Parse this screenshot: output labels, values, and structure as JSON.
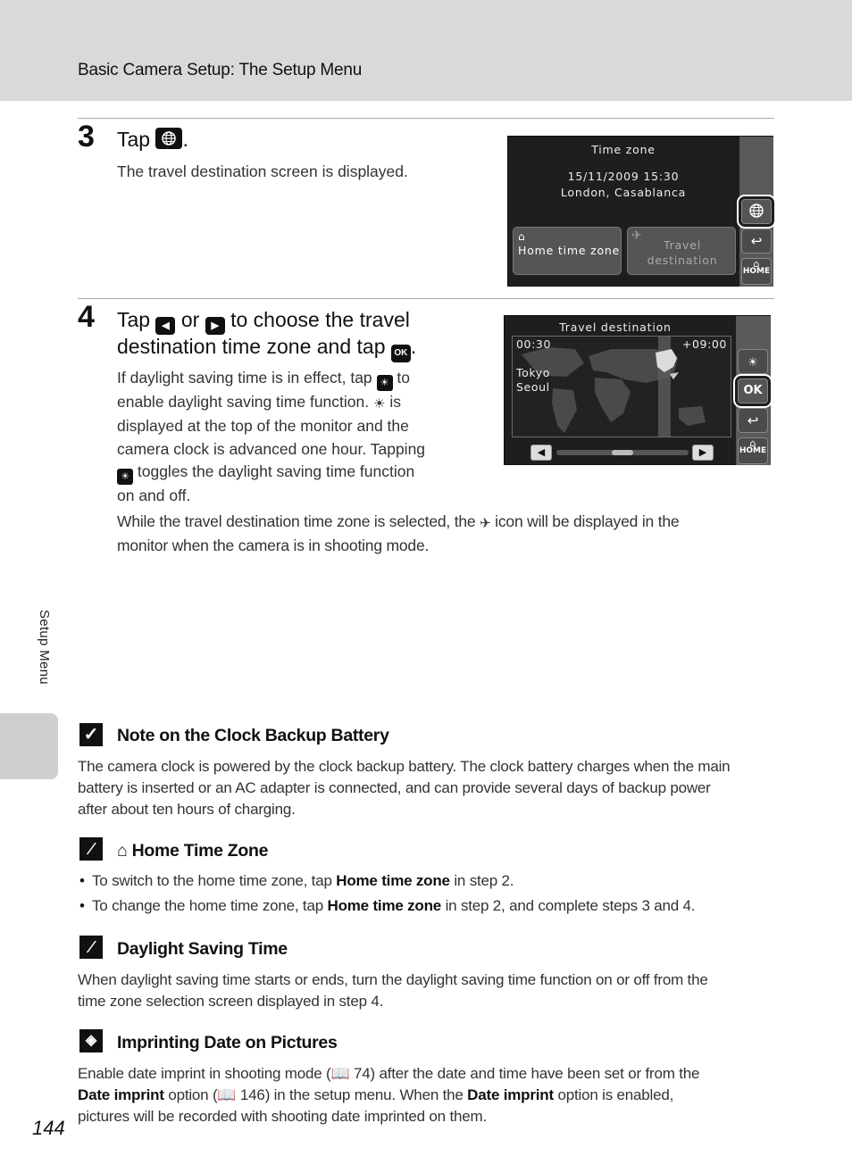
{
  "header": {
    "title": "Basic Camera Setup: The Setup Menu"
  },
  "side_tab": {
    "label": "Setup Menu"
  },
  "step3": {
    "number": "3",
    "heading_pre": "Tap",
    "heading_post": ".",
    "heading_icon": "globe-icon",
    "body": "The travel destination screen is displayed.",
    "screen": {
      "title": "Time zone",
      "datetime": "15/11/2009 15:30",
      "location": "London, Casablanca",
      "home_tile_label": "Home time zone",
      "travel_tile_label_1": "Travel",
      "travel_tile_label_2": "destination",
      "rail": [
        "globe-icon",
        "back-icon",
        "home-icon"
      ],
      "home_btn_label": "HOME"
    }
  },
  "step4": {
    "number": "4",
    "heading_1a": "Tap",
    "heading_1b": "or",
    "heading_1c": "to choose the travel",
    "heading_2a": "destination time zone and tap",
    "heading_2b": ".",
    "ok_icon_label": "OK",
    "para_1a": "If daylight saving time is in effect, tap",
    "para_1b": "to",
    "para_2a": "enable daylight saving time function.",
    "para_2b": "is",
    "para_3": "displayed at the top of the monitor and the",
    "para_4": "camera clock is advanced one hour. Tapping",
    "para_5": "toggles the daylight saving time function",
    "para_6": "on and off.",
    "para_wide_1a": "While the travel destination time zone is selected, the",
    "para_wide_1b": "icon will be displayed in the",
    "para_wide_2": "monitor when the camera is in shooting mode.",
    "screen": {
      "title": "Travel destination",
      "time": "00:30",
      "offset": "+09:00",
      "city_1": "Tokyo",
      "city_2": "Seoul",
      "ok_label": "OK",
      "home_btn_label": "HOME",
      "slider_position": 0.5
    }
  },
  "notes": [
    {
      "icon": "check-icon",
      "title": "Note on the Clock Backup Battery",
      "body_1": "The camera clock is powered by the clock backup battery. The clock battery charges when the main",
      "body_2": "battery is inserted or an AC adapter is connected, and can provide several days of backup power",
      "body_3": "after about ten hours of charging."
    },
    {
      "icon": "pencil-icon",
      "title": "Home Time Zone",
      "bullets": [
        {
          "pre": "To switch to the home time zone, tap",
          "bold": "Home time zone",
          "post": "in step 2."
        },
        {
          "pre": "To change the home time zone, tap",
          "bold": "Home time zone",
          "post": "in step 2, and complete steps 3 and 4."
        }
      ]
    },
    {
      "icon": "pencil-icon",
      "title": "Daylight Saving Time",
      "body_1": "When daylight saving time starts or ends, turn the daylight saving time function on or off from the",
      "body_2": "time zone selection screen displayed in step 4."
    },
    {
      "icon": "date-imprint-icon",
      "title": "Imprinting Date on Pictures",
      "line1_pre": "Enable date imprint in shooting mode (",
      "line1_ref": "74",
      "line1_post": ") after the date and time have been set or from the",
      "line2_bold1": "Date imprint",
      "line2_mid1": "option (",
      "line2_ref": "146",
      "line2_mid2": ") in the setup menu. When the",
      "line2_bold2": "Date imprint",
      "line2_post": "option is enabled,",
      "line3": "pictures will be recorded with shooting date imprinted on them."
    }
  ],
  "page_number": "144"
}
